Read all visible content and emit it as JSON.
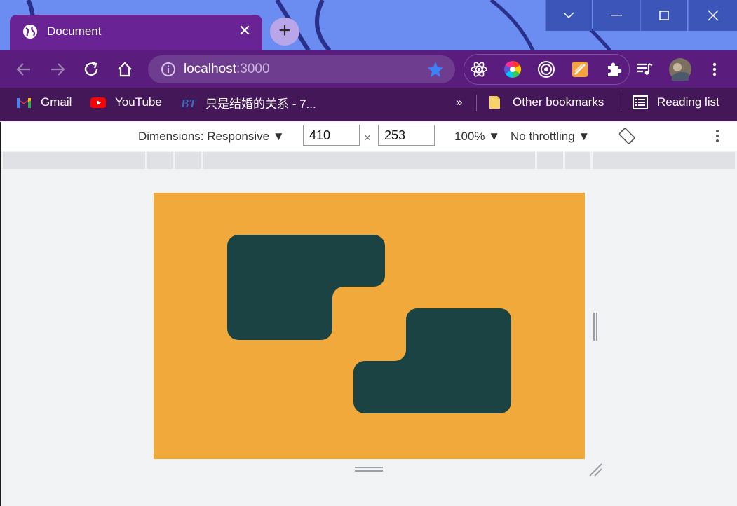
{
  "window": {
    "tab_title": "Document",
    "tab_close": "✕",
    "new_tab": "+",
    "controls": {
      "dropdown": "chevron-down-icon",
      "minimize": "minimize-icon",
      "maximize": "maximize-icon",
      "close": "close-icon"
    }
  },
  "toolbar": {
    "url_host": "localhost",
    "url_port": ":3000",
    "accent": "#1a73e8"
  },
  "bookmarks": {
    "items": [
      {
        "label": "Gmail"
      },
      {
        "label": "YouTube"
      },
      {
        "label": "只是结婚的关系 - 7..."
      }
    ],
    "overflow": "»",
    "other": "Other bookmarks",
    "reading_list": "Reading list"
  },
  "devtools": {
    "dimensions_label": "Dimensions: Responsive",
    "width": "410",
    "height": "253",
    "times": "×",
    "zoom": "100%",
    "throttling": "No throttling"
  },
  "page": {
    "background_color": "#f2a93c",
    "shape_color": "#1c4343"
  }
}
